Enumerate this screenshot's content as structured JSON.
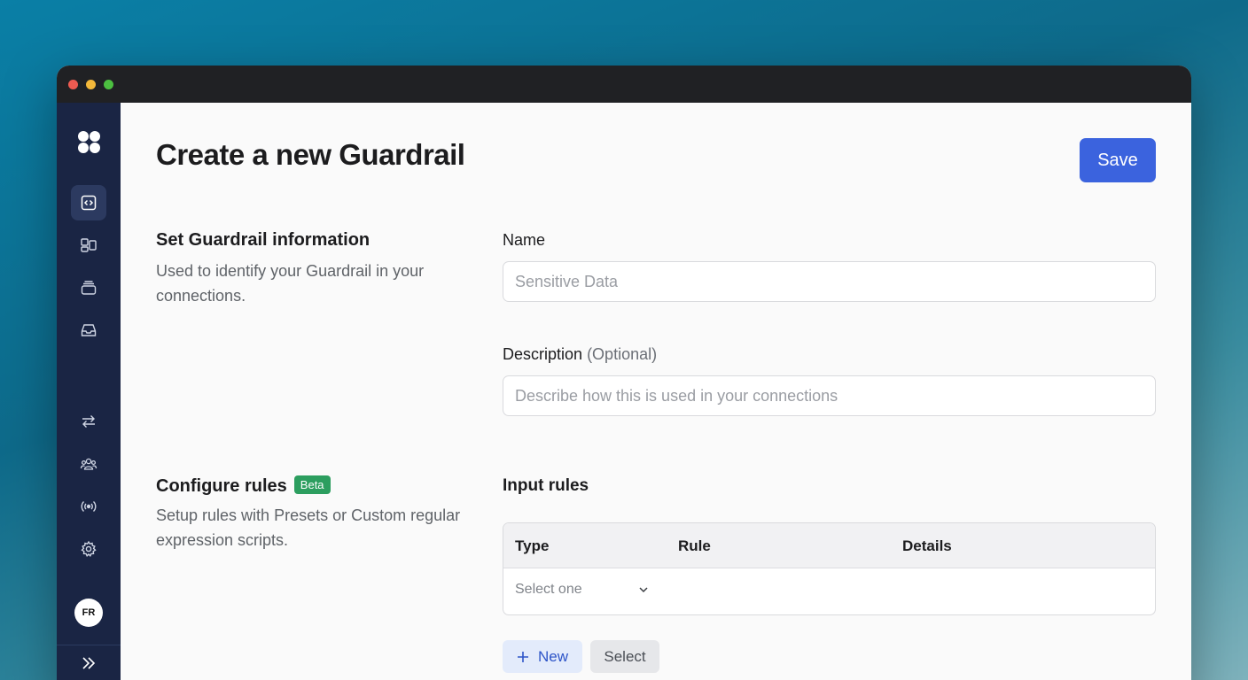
{
  "window": {
    "controls": [
      "close",
      "minimize",
      "maximize"
    ]
  },
  "sidebar": {
    "logo": "app-logo",
    "nav_top": [
      {
        "icon": "code-icon",
        "active": true
      },
      {
        "icon": "layout-icon",
        "active": false
      },
      {
        "icon": "stack-icon",
        "active": false
      },
      {
        "icon": "inbox-icon",
        "active": false
      }
    ],
    "nav_bottom": [
      {
        "icon": "arrows-icon"
      },
      {
        "icon": "users-icon"
      },
      {
        "icon": "broadcast-icon"
      },
      {
        "icon": "gear-icon"
      }
    ],
    "avatar_initials": "FR",
    "collapse_icon": "double-chevron-right-icon"
  },
  "header": {
    "title": "Create a new Guardrail",
    "save_label": "Save"
  },
  "info_section": {
    "title": "Set Guardrail information",
    "description": "Used to identify your Guardrail in your connections.",
    "name_label": "Name",
    "name_placeholder": "Sensitive Data",
    "description_label": "Description",
    "description_optional": "(Optional)",
    "description_placeholder": "Describe how this is used in your connections"
  },
  "rules_section": {
    "title": "Configure rules",
    "badge": "Beta",
    "description": "Setup rules with Presets or Custom regular expression scripts.",
    "input_rules_title": "Input rules",
    "columns": [
      "Type",
      "Rule",
      "Details"
    ],
    "type_select_placeholder": "Select one",
    "new_label": "New",
    "select_label": "Select"
  },
  "colors": {
    "accent": "#3b63de",
    "sidebar": "#1a2544",
    "beta": "#2c9e5f"
  }
}
